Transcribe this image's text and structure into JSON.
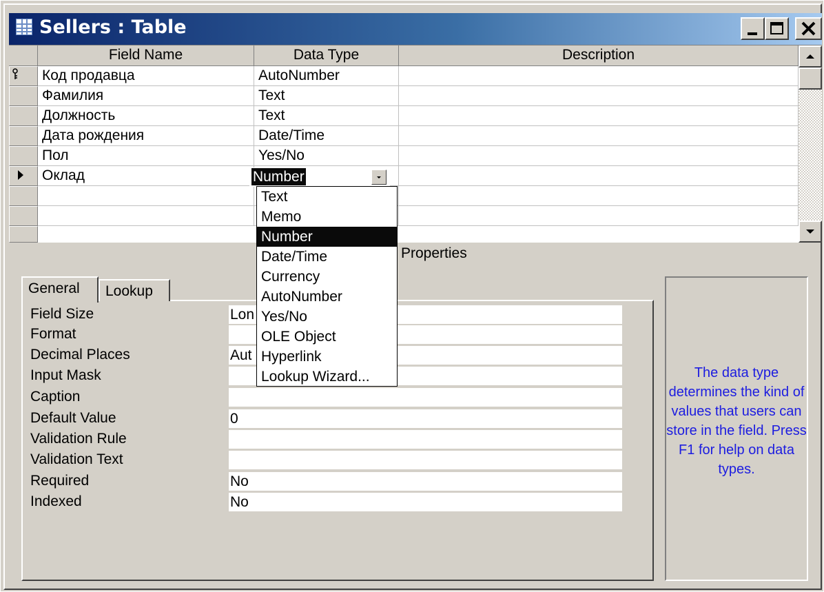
{
  "window": {
    "title": "Sellers : Table"
  },
  "grid": {
    "headers": [
      "Field Name",
      "Data Type",
      "Description"
    ],
    "rows": [
      {
        "field": "Код продавца",
        "type": "AutoNumber",
        "key": true
      },
      {
        "field": "Фамилия",
        "type": "Text"
      },
      {
        "field": "Должность",
        "type": "Text"
      },
      {
        "field": "Дата рождения",
        "type": "Date/Time"
      },
      {
        "field": "Пол",
        "type": "Yes/No"
      },
      {
        "field": "Оклад",
        "type": "Number",
        "current": true
      },
      {
        "field": "",
        "type": ""
      },
      {
        "field": "",
        "type": ""
      }
    ]
  },
  "combo": {
    "value": "Number",
    "options": [
      "Text",
      "Memo",
      "Number",
      "Date/Time",
      "Currency",
      "AutoNumber",
      "Yes/No",
      "OLE Object",
      "Hyperlink",
      "Lookup Wizard..."
    ],
    "selected_index": 2
  },
  "properties_label": "Properties",
  "tabs": [
    "General",
    "Lookup"
  ],
  "properties": [
    {
      "label": "Field Size",
      "value": "Lon"
    },
    {
      "label": "Format",
      "value": ""
    },
    {
      "label": "Decimal Places",
      "value": "Aut"
    },
    {
      "label": "Input Mask",
      "value": ""
    },
    {
      "label": "Caption",
      "value": ""
    },
    {
      "label": "Default Value",
      "value": "0"
    },
    {
      "label": "Validation Rule",
      "value": ""
    },
    {
      "label": "Validation Text",
      "value": ""
    },
    {
      "label": "Required",
      "value": "No"
    },
    {
      "label": "Indexed",
      "value": "No"
    }
  ],
  "help": "The data type determines the kind of values that users can store in the field. Press F1 for help on data types.",
  "colors": {
    "title_start": "#0a246a",
    "title_end": "#a6caf0",
    "help_text": "#1c1ce0",
    "face": "#d4d0c8"
  },
  "icons": [
    "table-icon",
    "minimize-icon",
    "maximize-icon",
    "close-icon",
    "key-icon",
    "record-pointer-icon",
    "scroll-up-icon",
    "scroll-down-icon",
    "dropdown-arrow-icon"
  ]
}
